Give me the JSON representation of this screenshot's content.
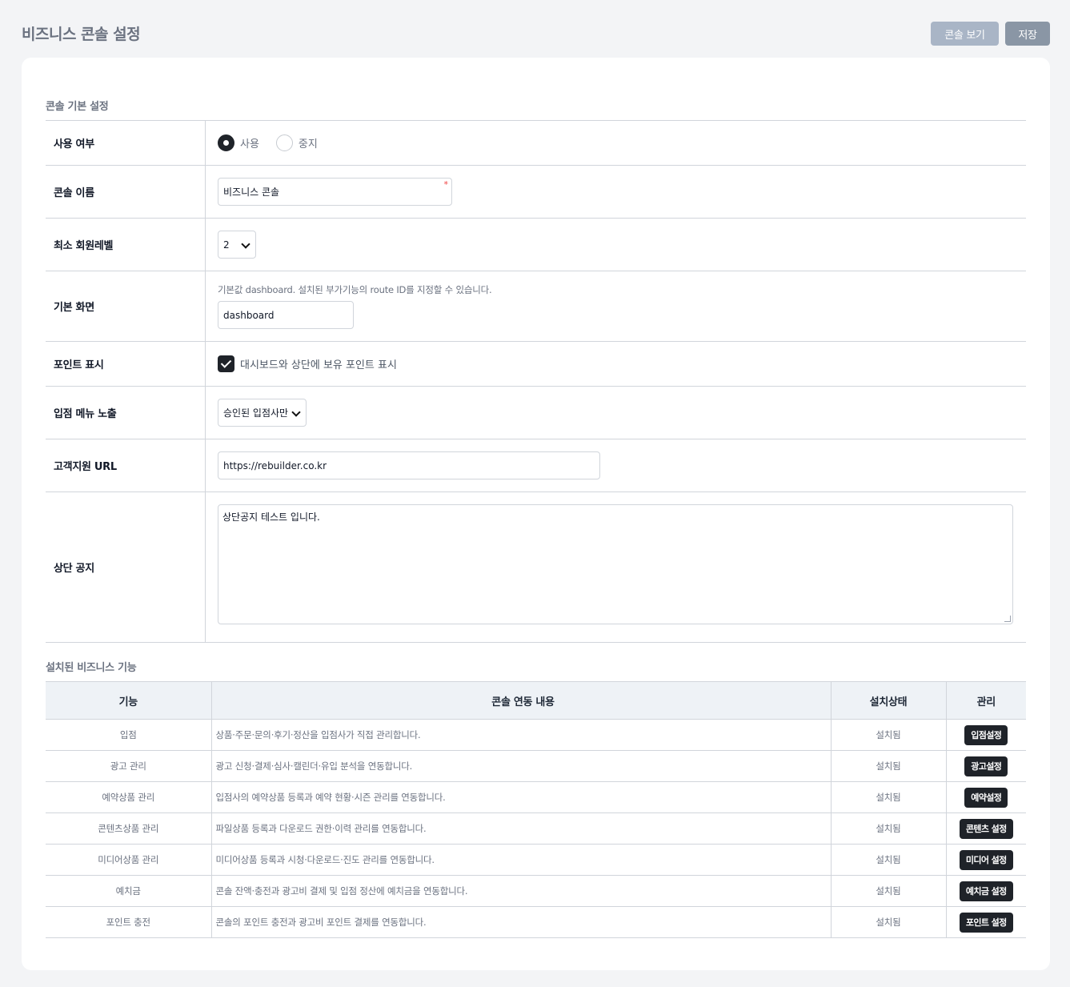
{
  "header": {
    "title": "비즈니스 콘솔 설정",
    "view_console_label": "콘솔 보기",
    "save_label": "저장"
  },
  "basic": {
    "section_title": "콘솔 기본 설정",
    "usage": {
      "label": "사용 여부",
      "options": [
        "사용",
        "중지"
      ],
      "selected": "사용"
    },
    "console_name": {
      "label": "콘솔 이름",
      "value": "비즈니스 콘솔",
      "required_mark": "*"
    },
    "min_level": {
      "label": "최소 회원레벨",
      "value": "2"
    },
    "default_screen": {
      "label": "기본 화면",
      "help": "기본값 dashboard. 설치된 부가기능의 route ID를 지정할 수 있습니다.",
      "value": "dashboard"
    },
    "point_display": {
      "label": "포인트 표시",
      "checkbox_label": "대시보드와 상단에 보유 포인트 표시",
      "checked": true
    },
    "store_menu": {
      "label": "입점 메뉴 노출",
      "value": "승인된 입점사만"
    },
    "support_url": {
      "label": "고객지원 URL",
      "value": "https://rebuilder.co.kr"
    },
    "top_notice": {
      "label": "상단 공지",
      "value": "상단공지 테스트 입니다."
    }
  },
  "features": {
    "section_title": "설치된 비즈니스 기능",
    "headers": [
      "기능",
      "콘솔 연동 내용",
      "설치상태",
      "관리"
    ],
    "rows": [
      {
        "name": "입점",
        "desc": "상품·주문·문의·후기·정산을 입점사가 직접 관리합니다.",
        "status": "설치됨",
        "action": "입점설정"
      },
      {
        "name": "광고 관리",
        "desc": "광고 신청·결제·심사·캘린더·유입 분석을 연동합니다.",
        "status": "설치됨",
        "action": "광고설정"
      },
      {
        "name": "예약상품 관리",
        "desc": "입점사의 예약상품 등록과 예약 현황·시즌 관리를 연동합니다.",
        "status": "설치됨",
        "action": "예약설정"
      },
      {
        "name": "콘텐츠상품 관리",
        "desc": "파일상품 등록과 다운로드 권한·이력 관리를 연동합니다.",
        "status": "설치됨",
        "action": "콘텐츠 설정"
      },
      {
        "name": "미디어상품 관리",
        "desc": "미디어상품 등록과 시청·다운로드·진도 관리를 연동합니다.",
        "status": "설치됨",
        "action": "미디어 설정"
      },
      {
        "name": "예치금",
        "desc": "콘솔 잔액·충전과 광고비 결제 및 입점 정산에 예치금을 연동합니다.",
        "status": "설치됨",
        "action": "예치금 설정"
      },
      {
        "name": "포인트 충전",
        "desc": "콘솔의 포인트 충전과 광고비 포인트 결제를 연동합니다.",
        "status": "설치됨",
        "action": "포인트 설정"
      }
    ]
  }
}
